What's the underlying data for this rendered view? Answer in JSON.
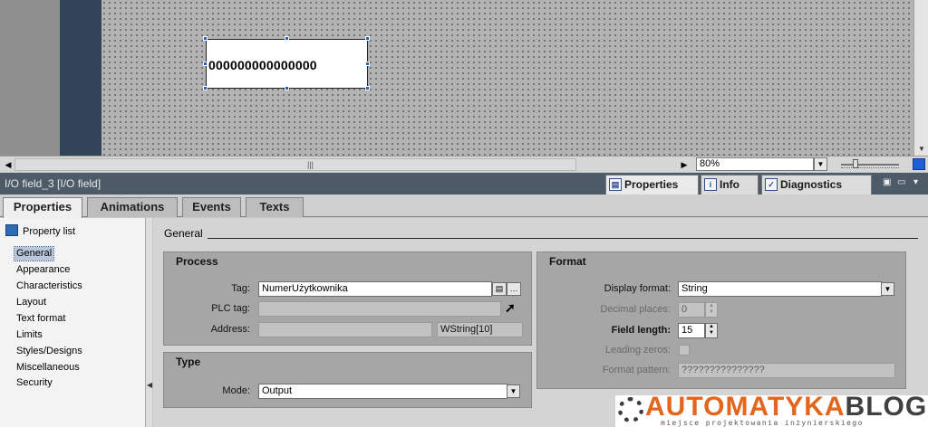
{
  "canvas": {
    "io_field_value": "000000000000000"
  },
  "toolbar": {
    "zoom_value": "80%"
  },
  "inspector": {
    "title": "I/O field_3 [I/O field]",
    "tabs": [
      {
        "label": "Properties",
        "icon": "properties-icon"
      },
      {
        "label": "Info",
        "icon": "info-icon"
      },
      {
        "label": "Diagnostics",
        "icon": "diagnostics-icon"
      }
    ],
    "subtabs": [
      "Properties",
      "Animations",
      "Events",
      "Texts"
    ]
  },
  "property_list": {
    "header": "Property list",
    "items": [
      "General",
      "Appearance",
      "Characteristics",
      "Layout",
      "Text format",
      "Limits",
      "Styles/Designs",
      "Miscellaneous",
      "Security"
    ],
    "selected": "General"
  },
  "general": {
    "section_title": "General",
    "process": {
      "title": "Process",
      "tag_label": "Tag:",
      "tag_value": "NumerUżytkownika",
      "plc_tag_label": "PLC tag:",
      "plc_tag_value": "",
      "address_label": "Address:",
      "address_value": "",
      "address_type": "WString[10]"
    },
    "type": {
      "title": "Type",
      "mode_label": "Mode:",
      "mode_value": "Output"
    },
    "format": {
      "title": "Format",
      "display_format_label": "Display format:",
      "display_format_value": "String",
      "decimal_places_label": "Decimal places:",
      "decimal_places_value": "0",
      "field_length_label": "Field length:",
      "field_length_value": "15",
      "leading_zeros_label": "Leading zeros:",
      "format_pattern_label": "Format pattern:",
      "format_pattern_value": "???????????????"
    }
  },
  "watermark": {
    "brand_part1": "AUTOMATYKA",
    "brand_part2": "BLOG",
    "tagline": "miejsce projektowania inżynierskiego",
    "brand_color": "#e2661b"
  },
  "colors": {
    "header_bg": "#4d5b68",
    "selection_blue": "#1f5fd6",
    "canvas_dark": "#324457"
  }
}
